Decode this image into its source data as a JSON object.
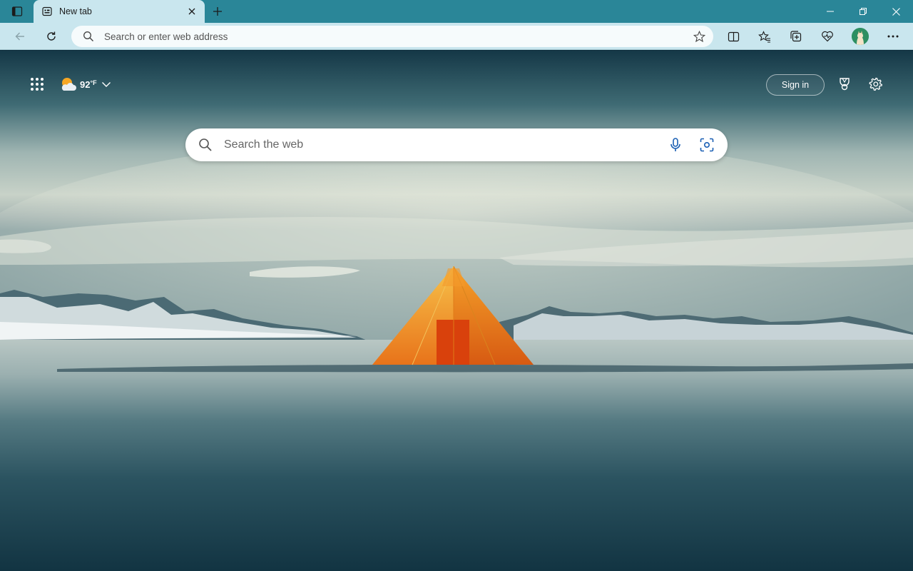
{
  "browser": {
    "tab": {
      "title": "New tab"
    },
    "address_bar": {
      "placeholder": "Search or enter web address"
    }
  },
  "newtab_page": {
    "weather": {
      "temperature": "92",
      "unit": "°F"
    },
    "signin_label": "Sign in",
    "search": {
      "placeholder": "Search the web"
    }
  },
  "icons": {
    "titlebar": [
      "tab-actions-icon",
      "new-tab-icon",
      "close-tab-icon",
      "minimize-icon",
      "restore-icon",
      "close-window-icon"
    ],
    "toolbar": [
      "back-icon",
      "refresh-icon",
      "search-icon",
      "favorite-star-icon",
      "split-screen-icon",
      "favorites-icon",
      "collections-icon",
      "browser-essentials-icon",
      "profile-avatar",
      "more-icon"
    ],
    "page": [
      "apps-grid-icon",
      "weather-partly-sunny-icon",
      "chevron-down-icon",
      "rewards-trophy-icon",
      "settings-gear-icon",
      "microphone-icon",
      "visual-search-icon"
    ]
  },
  "colors": {
    "titlebar": "#2a8698",
    "toolbar": "#c9e6ee",
    "tent": "#f08a1c"
  }
}
